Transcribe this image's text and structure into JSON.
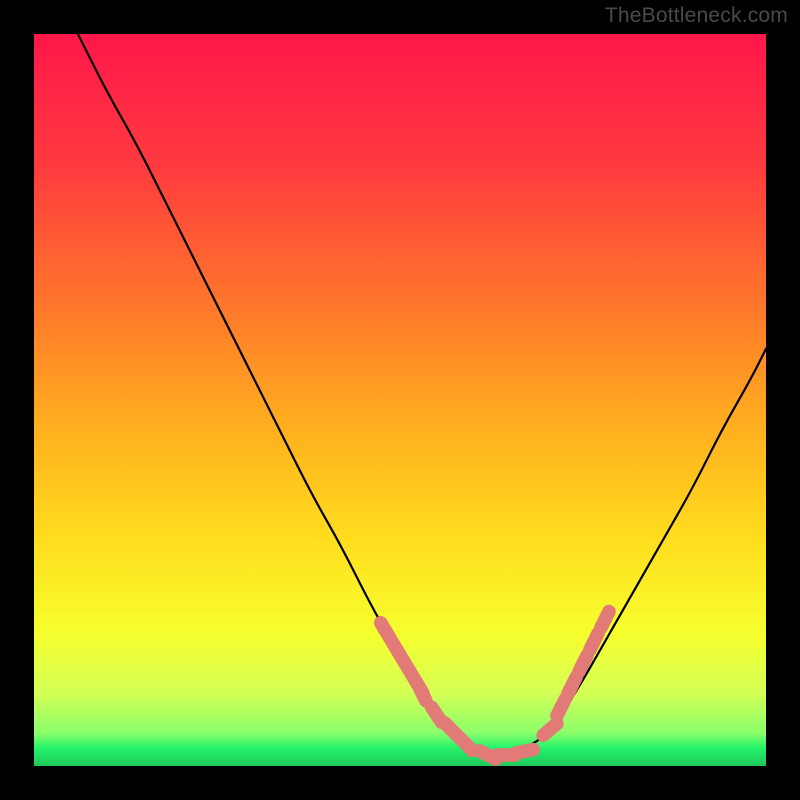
{
  "watermark": "TheBottleneck.com",
  "colors": {
    "background": "#000000",
    "curve_stroke": "#000000",
    "marker_fill": "#e27a77",
    "green_band": "#25f36b",
    "gradient_top": "#ff174a",
    "gradient_mid1": "#ff7a2a",
    "gradient_mid2": "#ffd21e",
    "gradient_mid3": "#f6ff2e",
    "gradient_mid4": "#d4ff55",
    "gradient_bottom": "#25f36b"
  },
  "chart_data": {
    "type": "line",
    "title": "",
    "xlabel": "",
    "ylabel": "",
    "xlim": [
      0,
      100
    ],
    "ylim": [
      0,
      100
    ],
    "grid": false,
    "series": [
      {
        "name": "bottleneck-curve",
        "x": [
          6,
          10,
          14,
          18,
          22,
          26,
          30,
          34,
          38,
          42,
          46,
          50,
          53,
          55,
          57,
          58,
          60,
          63,
          66,
          70,
          74,
          78,
          82,
          86,
          90,
          94,
          98,
          100
        ],
        "y": [
          100,
          92,
          85,
          77,
          69,
          61,
          53,
          45,
          37,
          30,
          22,
          15,
          10,
          7,
          5,
          3,
          2,
          1.5,
          2,
          4,
          10,
          17,
          24,
          31,
          38,
          46,
          53,
          57
        ]
      }
    ],
    "markers": {
      "name": "highlighted-points",
      "x": [
        48,
        49.5,
        51,
        52.5,
        53,
        55,
        57,
        59,
        62,
        64.5,
        67,
        70.5,
        72,
        73.5,
        75,
        76.5,
        78
      ],
      "y": [
        18.5,
        16,
        13.5,
        11,
        10,
        7,
        5,
        3,
        1.5,
        1.5,
        2,
        5,
        8,
        11,
        14,
        17,
        20
      ]
    }
  }
}
